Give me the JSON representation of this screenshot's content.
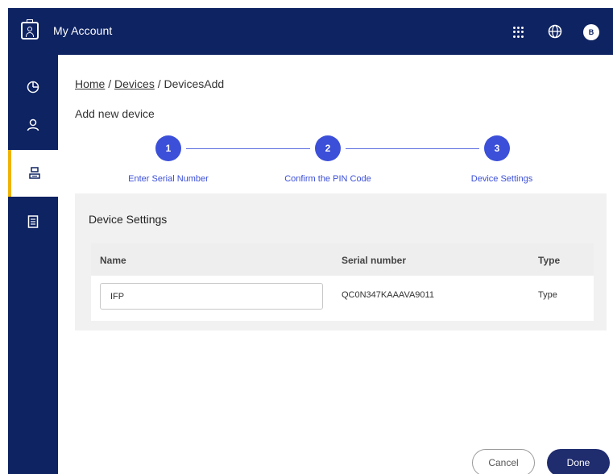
{
  "header": {
    "app_title": "My Account",
    "avatar_initial": "B",
    "icons": [
      "id-badge-icon",
      "apps-grid-icon",
      "globe-icon"
    ]
  },
  "sidebar": {
    "items": [
      {
        "icon": "dashboard-icon",
        "active": false
      },
      {
        "icon": "user-icon",
        "active": false
      },
      {
        "icon": "devices-icon",
        "active": true
      },
      {
        "icon": "document-icon",
        "active": false
      }
    ],
    "active_accent": "#f0b400"
  },
  "breadcrumb": {
    "home": "Home",
    "sep1": " / ",
    "devices": "Devices",
    "sep2": " / ",
    "current": "DevicesAdd"
  },
  "page": {
    "heading": "Add new device"
  },
  "stepper": {
    "steps": [
      {
        "number": "1",
        "label": "Enter Serial Number"
      },
      {
        "number": "2",
        "label": "Confirm the PIN Code"
      },
      {
        "number": "3",
        "label": "Device Settings"
      }
    ]
  },
  "settings": {
    "title": "Device Settings",
    "columns": {
      "name": "Name",
      "serial": "Serial number",
      "type": "Type"
    },
    "row": {
      "name_value": "IFP",
      "serial": "QC0N347KAAAVA9011",
      "type": "Type"
    }
  },
  "actions": {
    "cancel": "Cancel",
    "done": "Done"
  },
  "colors": {
    "navy": "#0e2362",
    "step_blue": "#3b4fd8",
    "done_button": "#1f2c6e",
    "panel_bg": "#f1f1f1"
  }
}
